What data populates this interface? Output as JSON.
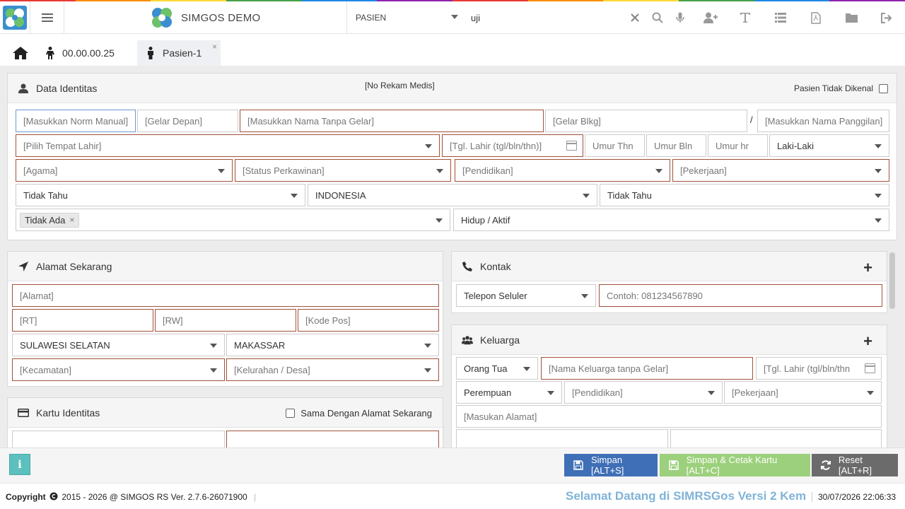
{
  "app": {
    "brand": "SIMGOS DEMO",
    "stripe_colors": [
      "#e53935",
      "#fb8c00",
      "#fdd835",
      "#43a047",
      "#1e88e5",
      "#8e24aa",
      "#e53935",
      "#fb8c00",
      "#fdd835",
      "#43a047",
      "#1e88e5",
      "#8e24aa"
    ]
  },
  "topbar": {
    "search_type": "PASIEN",
    "search_value": "uji",
    "icons": [
      "clear-icon",
      "search-icon",
      "microphone-icon",
      "add-user-icon",
      "text-icon",
      "list-icon",
      "pdf-icon",
      "folder-icon",
      "logout-icon"
    ]
  },
  "tabs": [
    {
      "label": ""
    },
    {
      "label": "00.00.00.25"
    },
    {
      "label": "Pasien-1",
      "close": "×"
    }
  ],
  "identitas": {
    "title": "Data Identitas",
    "center_label": "[No Rekam Medis]",
    "unknown_label": "Pasien Tidak Dikenal",
    "norm": "[Masukkan Norm Manual]",
    "gelar_depan": "[Gelar Depan]",
    "nama": "[Masukkan Nama Tanpa Gelar]",
    "gelar_blkg": "[Gelar Blkg]",
    "slash": "/",
    "panggilan": "[Masukkan Nama Panggilan]",
    "tempat_lahir": "[Pilih Tempat Lahir]",
    "tgl_lahir": "[Tgl. Lahir (tgl/bln/thn)]",
    "umur_thn": "Umur Thn",
    "umur_bln": "Umur Bln",
    "umur_hr": "Umur hr",
    "jenis_kelamin": "Laki-Laki",
    "agama": "[Agama]",
    "status_kawin": "[Status Perkawinan]",
    "pendidikan": "[Pendidikan]",
    "pekerjaan": "[Pekerjaan]",
    "gol_darah": "Tidak Tahu",
    "negara": "INDONESIA",
    "suku": "Tidak Tahu",
    "chip": "Tidak Ada",
    "chip_close": "×",
    "status_hidup": "Hidup / Aktif"
  },
  "alamat": {
    "title": "Alamat Sekarang",
    "alamat": "[Alamat]",
    "rt": "[RT]",
    "rw": "[RW]",
    "kode_pos": "[Kode Pos]",
    "provinsi": "SULAWESI SELATAN",
    "kota": "MAKASSAR",
    "kecamatan": "[Kecamatan]",
    "kelurahan": "[Kelurahan / Desa]"
  },
  "kartu": {
    "title": "Kartu Identitas",
    "same_label": "Sama Dengan Alamat Sekarang"
  },
  "kontak": {
    "title": "Kontak",
    "add": "+",
    "jenis": "Telepon Seluler",
    "nomor_placeholder": "Contoh: 081234567890"
  },
  "keluarga": {
    "title": "Keluarga",
    "add": "+",
    "hubungan": "Orang Tua",
    "nama": "[Nama Keluarga tanpa Gelar]",
    "tgl_lahir": "[Tgl. Lahir (tgl/bln/thn",
    "jenis_kelamin": "Perempuan",
    "pendidikan": "[Pendidikan]",
    "pekerjaan": "[Pekerjaan]",
    "alamat": "[Masukan Alamat]"
  },
  "actions": {
    "info": "i",
    "simpan": "Simpan [ALT+S]",
    "simpan_cetak": "Simpan & Cetak Kartu [ALT+C]",
    "reset": "Reset [ALT+R]",
    "colors": {
      "simpan": "#3f6fb6",
      "simpan_cetak": "#9cd07c",
      "reset": "#6b6b6b"
    }
  },
  "footer": {
    "copyright_label": "Copyright",
    "copyright_rest": "2015 - 2026 @ SIMGOS RS Ver. 2.7.6-26071900",
    "marquee": "Selamat Datang di SIMRSGos Versi 2 Kem",
    "datetime": "30/07/2026 22:06:33"
  }
}
